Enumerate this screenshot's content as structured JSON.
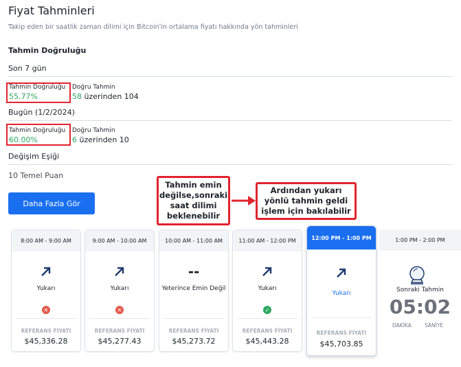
{
  "header": {
    "title": "Fiyat Tahminleri",
    "subtitle": "Takip eden bir saatlik zaman dilimi için Bitcoin'in ortalama fiyatı hakkında yön tahminleri"
  },
  "accuracy": {
    "section_title": "Tahmin Doğruluğu",
    "periods": [
      {
        "label": "Son 7 gün",
        "accuracy_label": "Tahmin Doğruluğu",
        "accuracy_value": "55.77%",
        "correct_label": "Doğru Tahmin",
        "correct_count": "58",
        "correct_suffix": "üzerinden 104"
      },
      {
        "label": "Bugün (1/2/2024)",
        "accuracy_label": "Tahmin Doğruluğu",
        "accuracy_value": "60.00%",
        "correct_label": "Doğru Tahmin",
        "correct_count": "6",
        "correct_suffix": "üzerinden 10"
      }
    ],
    "threshold_label": "Değişim Eşiği",
    "threshold_value": "10 Temel Puan"
  },
  "more_button": "Daha Fazla Gör",
  "callouts": {
    "left": "Tahmin emin değilse,sonraki saat dilimi beklenebilir",
    "right": "Ardından yukarı yönlü tahmin geldi işlem için bakılabilir"
  },
  "colors": {
    "accent": "#1a6ff1",
    "success": "#2ea862",
    "fail": "#e25b4b",
    "highlight": "#e0242f"
  },
  "cards": [
    {
      "time": "8:00 AM - 9:00 AM",
      "direction": "Yukarı",
      "icon": "arrow-up-right-icon",
      "result": "wrong",
      "ref_label": "REFERANS FİYATI",
      "price": "$45,336.28"
    },
    {
      "time": "9:00 AM - 10:00 AM",
      "direction": "Yukarı",
      "icon": "arrow-up-right-icon",
      "result": "wrong",
      "ref_label": "REFERANS FİYATI",
      "price": "$45,277.43"
    },
    {
      "time": "10:00 AM - 11:00 AM",
      "direction": "Yeterince Emin Değil",
      "icon": "double-dash-icon",
      "result": "none",
      "ref_label": "REFERANS FİYATI",
      "price": "$45,273.72"
    },
    {
      "time": "11:00 AM - 12:00 PM",
      "direction": "Yukarı",
      "icon": "arrow-up-right-icon",
      "result": "correct",
      "ref_label": "REFERANS FİYATI",
      "price": "$45,443.28"
    },
    {
      "time": "12:00 PM - 1:00 PM",
      "direction": "Yukarı",
      "icon": "arrow-up-right-icon",
      "result": "pending",
      "ref_label": "REFERANS FİYATI",
      "price": "$45,703.85"
    }
  ],
  "next_card": {
    "time": "1:00 PM - 2:00 PM",
    "label": "Sonraki Tahmin",
    "countdown": "05:02",
    "minutes_label": "DAKİKA",
    "seconds_label": "SANİYE"
  }
}
